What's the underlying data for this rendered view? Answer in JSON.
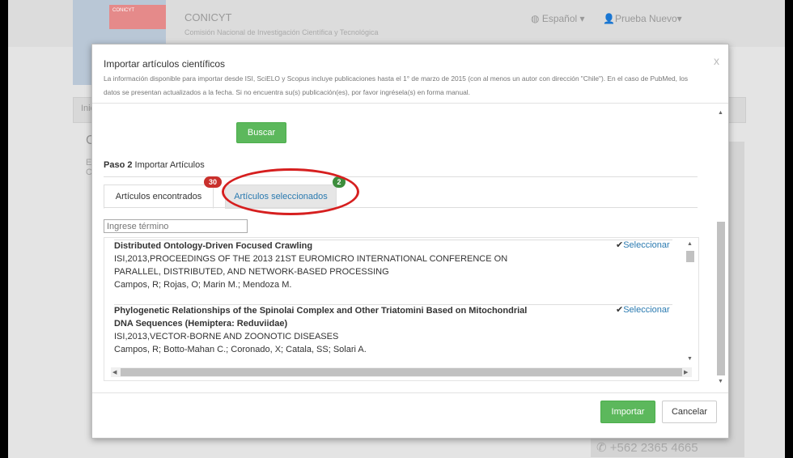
{
  "background": {
    "logo_text": "CONICYT",
    "app_title": "CONICYT",
    "app_subtitle": "Comisión Nacional de Investigación Científica y Tecnológica",
    "language": "Español",
    "user": "Prueba Nuevo",
    "nav_fragment": "Inic",
    "heading_fragment": "Cu",
    "text_fragment": "El",
    "text_fragment2": "CO",
    "phone": "+562 2365 4665"
  },
  "modal": {
    "close": "x",
    "title": "Importar artículos científicos",
    "description": "La información disponible para importar desde ISI, SciELO y Scopus incluye publicaciones hasta el 1° de marzo de 2015 (con al menos un autor con dirección \"Chile\"). En el caso de PubMed, los datos se presentan actualizados a la fecha. Si no encuentra su(s) publicación(es), por favor ingrésela(s) en forma manual.",
    "search_button": "Buscar",
    "step_label": "Paso 2",
    "step_text": "Importar Artículos",
    "tabs": [
      {
        "label": "Artículos encontrados",
        "badge": "30"
      },
      {
        "label": "Artículos seleccionados",
        "badge": "2"
      }
    ],
    "filter_placeholder": "Ingrese término",
    "articles": [
      {
        "title": "Distributed Ontology-Driven Focused Crawling",
        "source_line1": "ISI,2013,PROCEEDINGS OF THE 2013 21ST EUROMICRO INTERNATIONAL CONFERENCE ON",
        "source_line2": "PARALLEL, DISTRIBUTED, AND NETWORK-BASED PROCESSING",
        "authors": "Campos, R; Rojas, O; Marin M.; Mendoza M.",
        "action": "Seleccionar"
      },
      {
        "title_line1": "Phylogenetic Relationships of the Spinolai Complex and Other Triatomini Based on Mitochondrial",
        "title_line2": "DNA Sequences (Hemiptera: Reduviidae)",
        "source_line1": "ISI,2013,VECTOR-BORNE AND ZOONOTIC DISEASES",
        "authors": "Campos, R; Botto-Mahan C.; Coronado, X; Catala, SS; Solari A.",
        "action": "Seleccionar"
      }
    ],
    "import_button": "Importar",
    "cancel_button": "Cancelar"
  },
  "colors": {
    "primary_green": "#5cb85c",
    "link_blue": "#2a7ab0",
    "badge_red": "#c9302c",
    "badge_green": "#3c8d3c",
    "annotation_red": "#d61f1f"
  }
}
